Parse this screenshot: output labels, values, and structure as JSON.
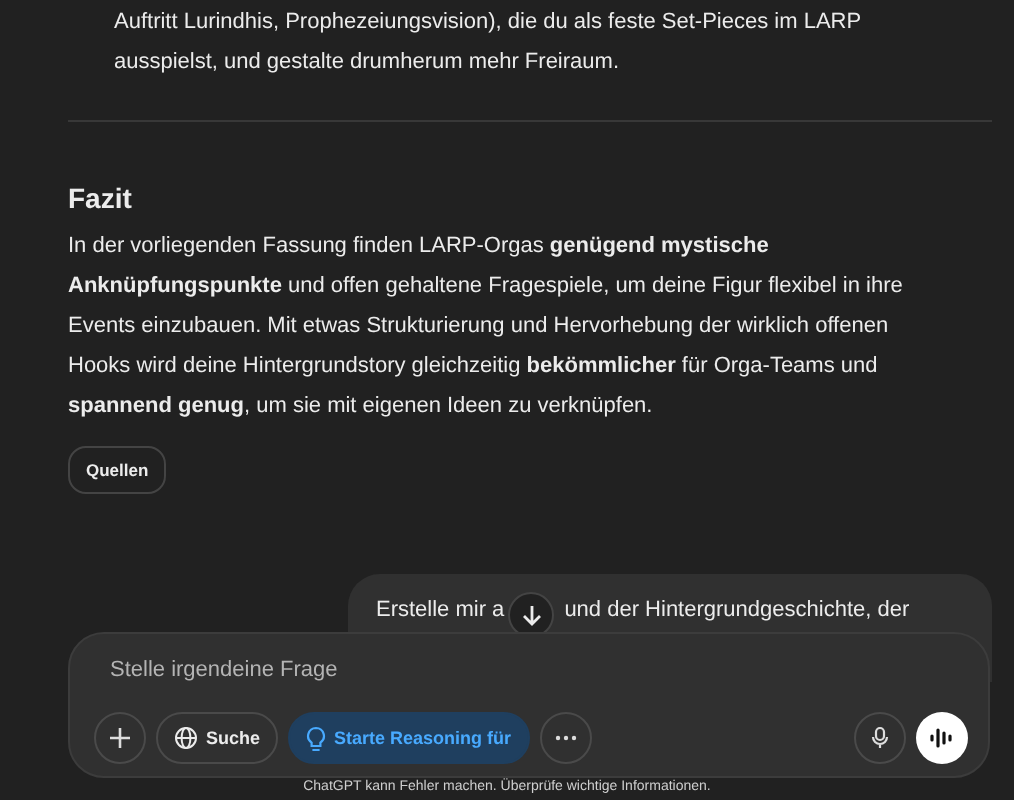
{
  "article": {
    "list_continuation": [
      "Auftritt Lurindhis, Prophezeiungsvision), die du als feste Set-Pieces im LARP",
      "ausspielst, und gestalte drumherum mehr Freiraum."
    ],
    "heading": "Fazit",
    "paragraph": "In der vorliegenden Fassung finden LARP-Orgas **genügend mystische Anknüpfungspunkte** und offen gehaltene Fragespiele, um deine Figur flexibel in ihre Events einzubauen. Mit etwas Strukturierung und Hervorhebung der wirklich offenen Hooks wird deine Hintergrundstory gleichzeitig **bekömmlicher** für Orga-Teams und **spannend genug**, um sie mit eigenen Ideen zu verknüpfen.",
    "sources_button": "Quellen"
  },
  "user_message": [
    "Erstelle mir a",
    "und der Hintergrundgeschichte, der"
  ],
  "composer": {
    "placeholder": "Stelle irgendeine Frage",
    "tools": [
      {
        "kind": "plus"
      },
      {
        "kind": "search",
        "label": "Suche",
        "selected": false
      },
      {
        "kind": "reason",
        "label": "Starte Reasoning für",
        "selected": true
      },
      {
        "kind": "more"
      }
    ]
  },
  "footer": "ChatGPT kann Fehler machen. Überprüfe wichtige Informationen."
}
